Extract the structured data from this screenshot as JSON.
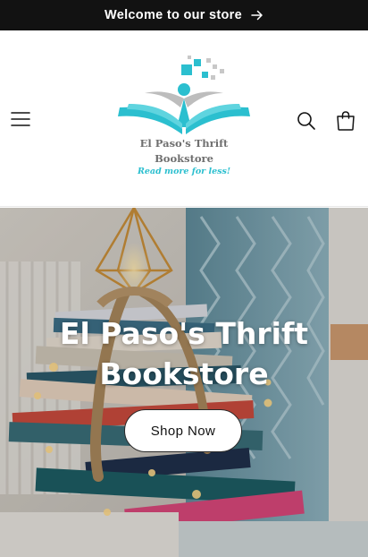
{
  "announcement": {
    "text": "Welcome to our store",
    "arrow_icon": "arrow-right-icon"
  },
  "header": {
    "menu_icon": "hamburger-menu-icon",
    "search_icon": "search-icon",
    "cart_icon": "shopping-bag-icon",
    "logo": {
      "line1": "El Paso's Thrift",
      "line2": "Bookstore",
      "tagline": "Read more for less!",
      "colors": {
        "teal": "#2bbfcf",
        "gray": "#6f6f6f"
      }
    }
  },
  "hero": {
    "title_line1": "El Paso's Thrift",
    "title_line2": "Bookstore",
    "button_label": "Shop Now"
  },
  "colors": {
    "announcement_bg": "#121212",
    "accent": "#2bbfcf"
  }
}
